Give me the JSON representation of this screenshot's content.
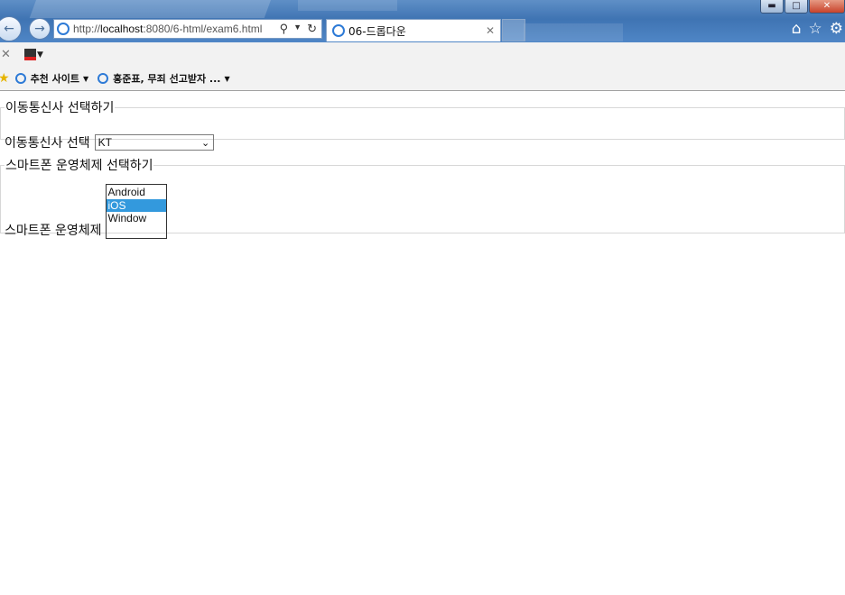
{
  "browser": {
    "url_prefix": "http://",
    "url_host": "localhost",
    "url_rest": ":8080/6-html/exam6.html",
    "tab_title": "06-드롭다운",
    "nav_back_icon": "arrow-left-icon",
    "nav_forward_icon": "arrow-right-icon",
    "window_controls": [
      "minimize",
      "maximize",
      "close"
    ],
    "right_icons": [
      "home-icon",
      "star-icon",
      "gear-icon"
    ],
    "favorites": [
      {
        "label": "추천 사이트"
      },
      {
        "label": "홍준표, 무죄 선고받자 ..."
      }
    ],
    "accent_color": "#3f74b3"
  },
  "page": {
    "carrier_section": {
      "legend": "이동통신사 선택하기",
      "label": "이동통신사 선택",
      "selected_value": "KT"
    },
    "os_section": {
      "legend": "스마트폰 운영체제 선택하기",
      "label": "스마트폰 운영체제",
      "options": [
        "Android",
        "iOS",
        "Window"
      ],
      "selected_value": "iOS",
      "selected_color": "#3399dd"
    }
  }
}
